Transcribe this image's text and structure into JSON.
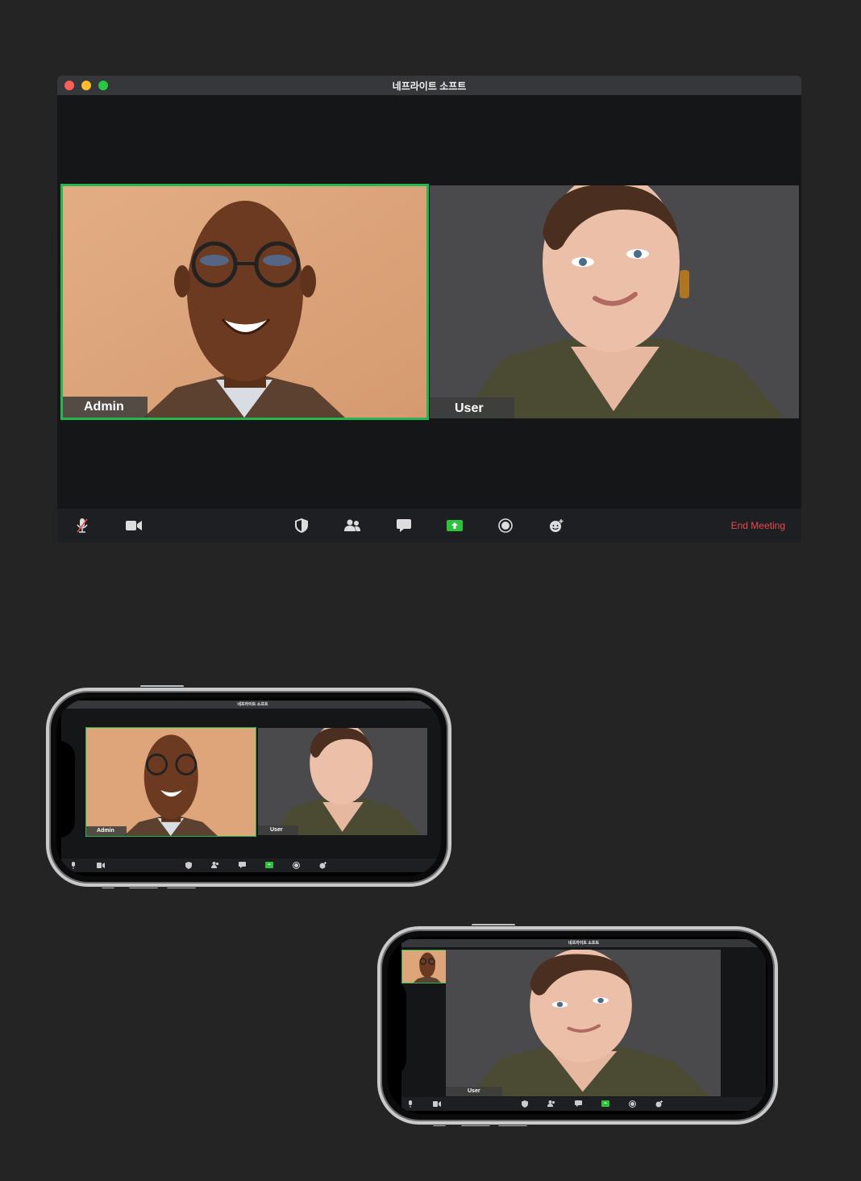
{
  "window": {
    "title": "네프라이트 소프트",
    "controls": [
      "close",
      "minimize",
      "zoom"
    ]
  },
  "participants": [
    {
      "name": "Admin",
      "active_speaker": true
    },
    {
      "name": "User",
      "active_speaker": false
    }
  ],
  "toolbar": {
    "left": [
      {
        "icon": "microphone-muted-icon"
      },
      {
        "icon": "video-camera-icon"
      }
    ],
    "center": [
      {
        "icon": "security-shield-icon"
      },
      {
        "icon": "participants-icon"
      },
      {
        "icon": "chat-icon"
      },
      {
        "icon": "share-screen-icon"
      },
      {
        "icon": "record-icon"
      },
      {
        "icon": "reactions-icon"
      }
    ],
    "end_meeting_label": "End Meeting"
  },
  "phone_gallery": {
    "title": "네프라이트 소프트",
    "admin_label": "Admin",
    "user_label": "User"
  },
  "phone_speaker": {
    "title": "네프라이트 소프트",
    "user_label": "User"
  },
  "colors": {
    "background": "#242424",
    "window": "#151618",
    "titlebar": "#36373a",
    "active_border": "#25b64f",
    "share_green": "#2ec23a",
    "end_meeting": "#e8494c"
  }
}
